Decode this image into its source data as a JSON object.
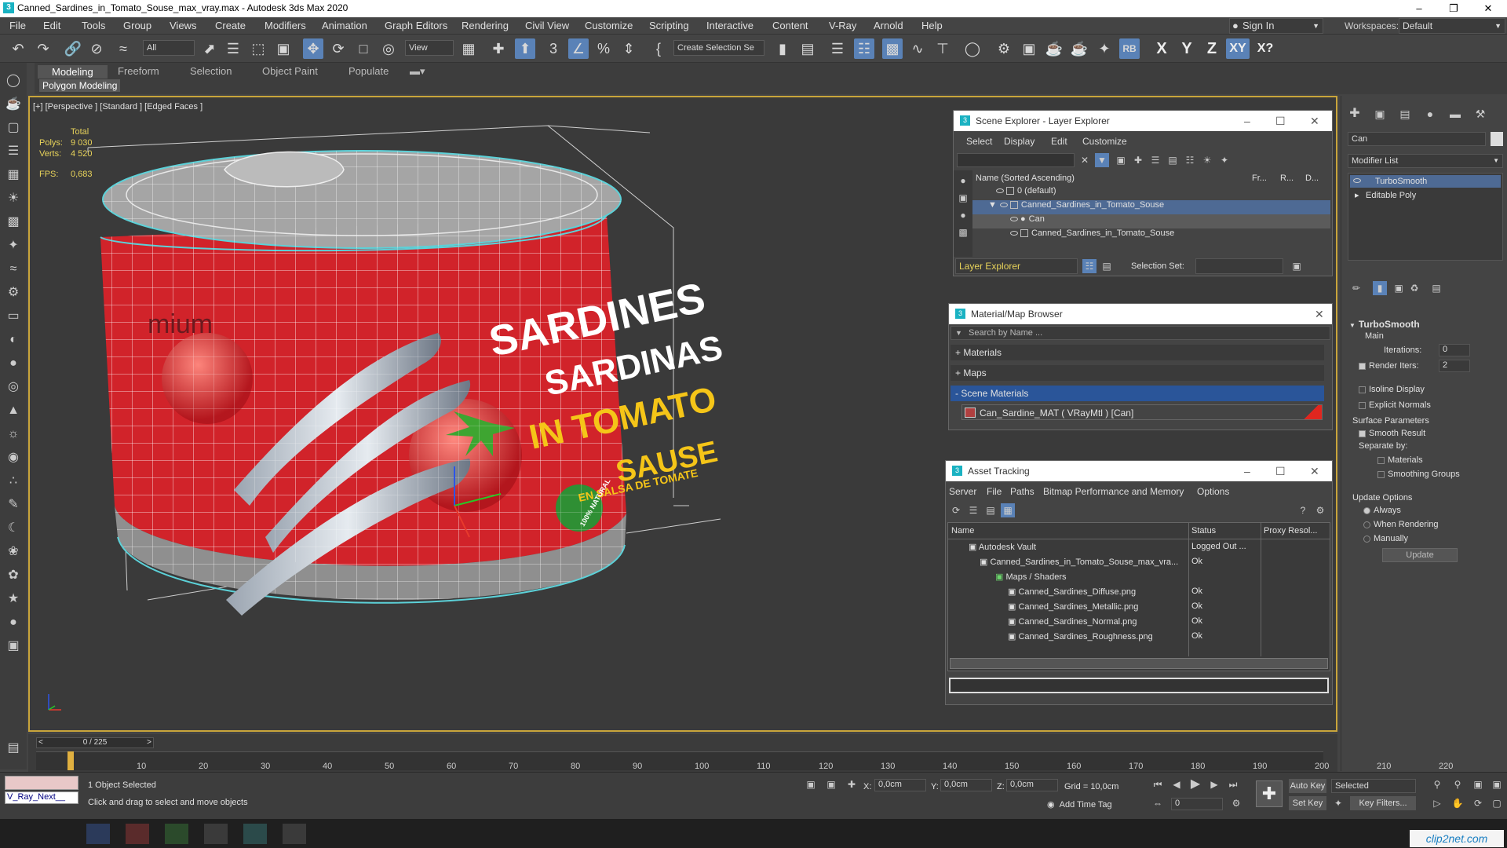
{
  "window": {
    "title": "Canned_Sardines_in_Tomato_Souse_max_vray.max - Autodesk 3ds Max 2020",
    "logo": "3"
  },
  "menus": [
    "File",
    "Edit",
    "Tools",
    "Group",
    "Views",
    "Create",
    "Modifiers",
    "Animation",
    "Graph Editors",
    "Rendering",
    "Civil View",
    "Customize",
    "Scripting",
    "Interactive",
    "Content",
    "V-Ray",
    "Arnold",
    "Help"
  ],
  "account": {
    "sign_in": "Sign In",
    "workspaces_label": "Workspaces:",
    "workspace": "Default"
  },
  "toolbar": {
    "filter": "All",
    "ref_coord": "View",
    "selection_set": "Create Selection Se",
    "rb_label": "RB",
    "axis_x": "X",
    "axis_y": "Y",
    "axis_z": "Z",
    "axis_xy": "XY",
    "axis_xq": "X?"
  },
  "ribbon": {
    "tabs": [
      "Modeling",
      "Freeform",
      "Selection",
      "Object Paint",
      "Populate"
    ],
    "active_tab": "Modeling",
    "sub_label": "Polygon Modeling"
  },
  "viewport": {
    "label": "[+] [Perspective ] [Standard ] [Edged Faces ]",
    "stats": {
      "total_label": "Total",
      "polys_label": "Polys:",
      "polys_value": "9 030",
      "verts_label": "Verts:",
      "verts_value": "4 520",
      "fps_label": "FPS:",
      "fps_value": "0,683"
    },
    "can_text": {
      "line1": "SARDINES",
      "line2": "SARDINAS",
      "line3": "IN TOMATO",
      "line4": "SAUSE",
      "line5": "EN SALSA DE TOMATE",
      "badge": "100% NATURAL",
      "side": "mium"
    }
  },
  "scene_explorer": {
    "title": "Scene Explorer - Layer Explorer",
    "menus": [
      "Select",
      "Display",
      "Edit",
      "Customize"
    ],
    "col_name": "Name (Sorted Ascending)",
    "col_fr": "Fr...",
    "col_r": "R...",
    "col_d": "D...",
    "rows": [
      {
        "name": "0 (default)",
        "indent": 0
      },
      {
        "name": "Canned_Sardines_in_Tomato_Souse",
        "indent": 0
      },
      {
        "name": "Can",
        "indent": 1
      },
      {
        "name": "Canned_Sardines_in_Tomato_Souse",
        "indent": 1
      }
    ],
    "footer_layer": "Layer Explorer",
    "selection_set_label": "Selection Set:"
  },
  "material_browser": {
    "title": "Material/Map Browser",
    "search_placeholder": "Search by Name ...",
    "groups": [
      "+ Materials",
      "+ Maps",
      "- Scene Materials"
    ],
    "material": "Can_Sardine_MAT ( VRayMtl ) [Can]"
  },
  "asset_tracking": {
    "title": "Asset Tracking",
    "menus": [
      "Server",
      "File",
      "Paths",
      "Bitmap Performance and Memory",
      "Options"
    ],
    "columns": [
      "Name",
      "Status",
      "Proxy Resol..."
    ],
    "rows": [
      {
        "name": "Autodesk Vault",
        "status": "Logged Out ...",
        "indent": 0
      },
      {
        "name": "Canned_Sardines_in_Tomato_Souse_max_vra...",
        "status": "Ok",
        "indent": 1
      },
      {
        "name": "Maps / Shaders",
        "status": "",
        "indent": 2
      },
      {
        "name": "Canned_Sardines_Diffuse.png",
        "status": "Ok",
        "indent": 3
      },
      {
        "name": "Canned_Sardines_Metallic.png",
        "status": "Ok",
        "indent": 3
      },
      {
        "name": "Canned_Sardines_Normal.png",
        "status": "Ok",
        "indent": 3
      },
      {
        "name": "Canned_Sardines_Roughness.png",
        "status": "Ok",
        "indent": 3
      }
    ]
  },
  "command_panel": {
    "object_name": "Can",
    "modifier_list": "Modifier List",
    "stack": [
      "TurboSmooth",
      "Editable Poly"
    ],
    "rollout_title": "TurboSmooth",
    "main_label": "Main",
    "iterations_label": "Iterations:",
    "iterations_value": "0",
    "render_iters_label": "Render Iters:",
    "render_iters_value": "2",
    "isoline": "Isoline Display",
    "explicit_normals": "Explicit Normals",
    "surface_params": "Surface Parameters",
    "smooth_result": "Smooth Result",
    "separate_by": "Separate by:",
    "sep_materials": "Materials",
    "sep_smoothing": "Smoothing Groups",
    "update_options": "Update Options",
    "always": "Always",
    "when_rendering": "When Rendering",
    "manually": "Manually",
    "update_btn": "Update"
  },
  "timeline": {
    "frame": "0 / 225",
    "ticks": [
      "10",
      "20",
      "30",
      "40",
      "50",
      "60",
      "70",
      "80",
      "90",
      "100",
      "110",
      "120",
      "130",
      "140",
      "150",
      "160",
      "170",
      "180",
      "190",
      "200",
      "210",
      "220"
    ]
  },
  "status": {
    "renderer": "V_Ray_Next__",
    "selected": "1 Object Selected",
    "prompt": "Click and drag to select and move objects",
    "x_label": "X:",
    "x_value": "0,0cm",
    "y_label": "Y:",
    "y_value": "0,0cm",
    "z_label": "Z:",
    "z_value": "0,0cm",
    "grid": "Grid = 10,0cm",
    "add_time_tag": "Add Time Tag",
    "auto_key": "Auto Key",
    "set_key": "Set Key",
    "key_mode": "Selected",
    "key_filters": "Key Filters...",
    "frame_value": "0",
    "watermark": "clip2net.com"
  },
  "colors": {
    "accent": "#5a82b7",
    "viewport_border": "#c9a53b",
    "can_red": "#d1232a",
    "wire": "#ffffff",
    "selection": "#5cd1d8"
  }
}
